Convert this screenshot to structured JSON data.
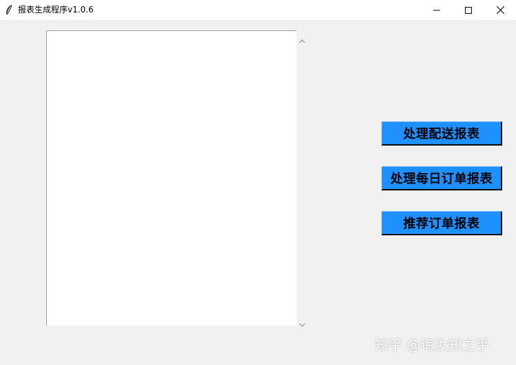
{
  "window": {
    "title": "报表生成程序v1.0.6",
    "icon": "feather-icon",
    "controls": [
      "minimize-icon",
      "maximize-icon",
      "close-icon"
    ]
  },
  "log_area": {
    "value": ""
  },
  "buttons": {
    "delivery_report": "处理配送报表",
    "daily_order_report": "处理每日订单报表",
    "recommended_order_report": "推荐订单报表"
  },
  "watermark": "知乎 @诲汝知之乎",
  "colors": {
    "button_bg": "#1e90ff",
    "window_bg": "#f0f0f0",
    "titlebar_bg": "#ffffff"
  }
}
